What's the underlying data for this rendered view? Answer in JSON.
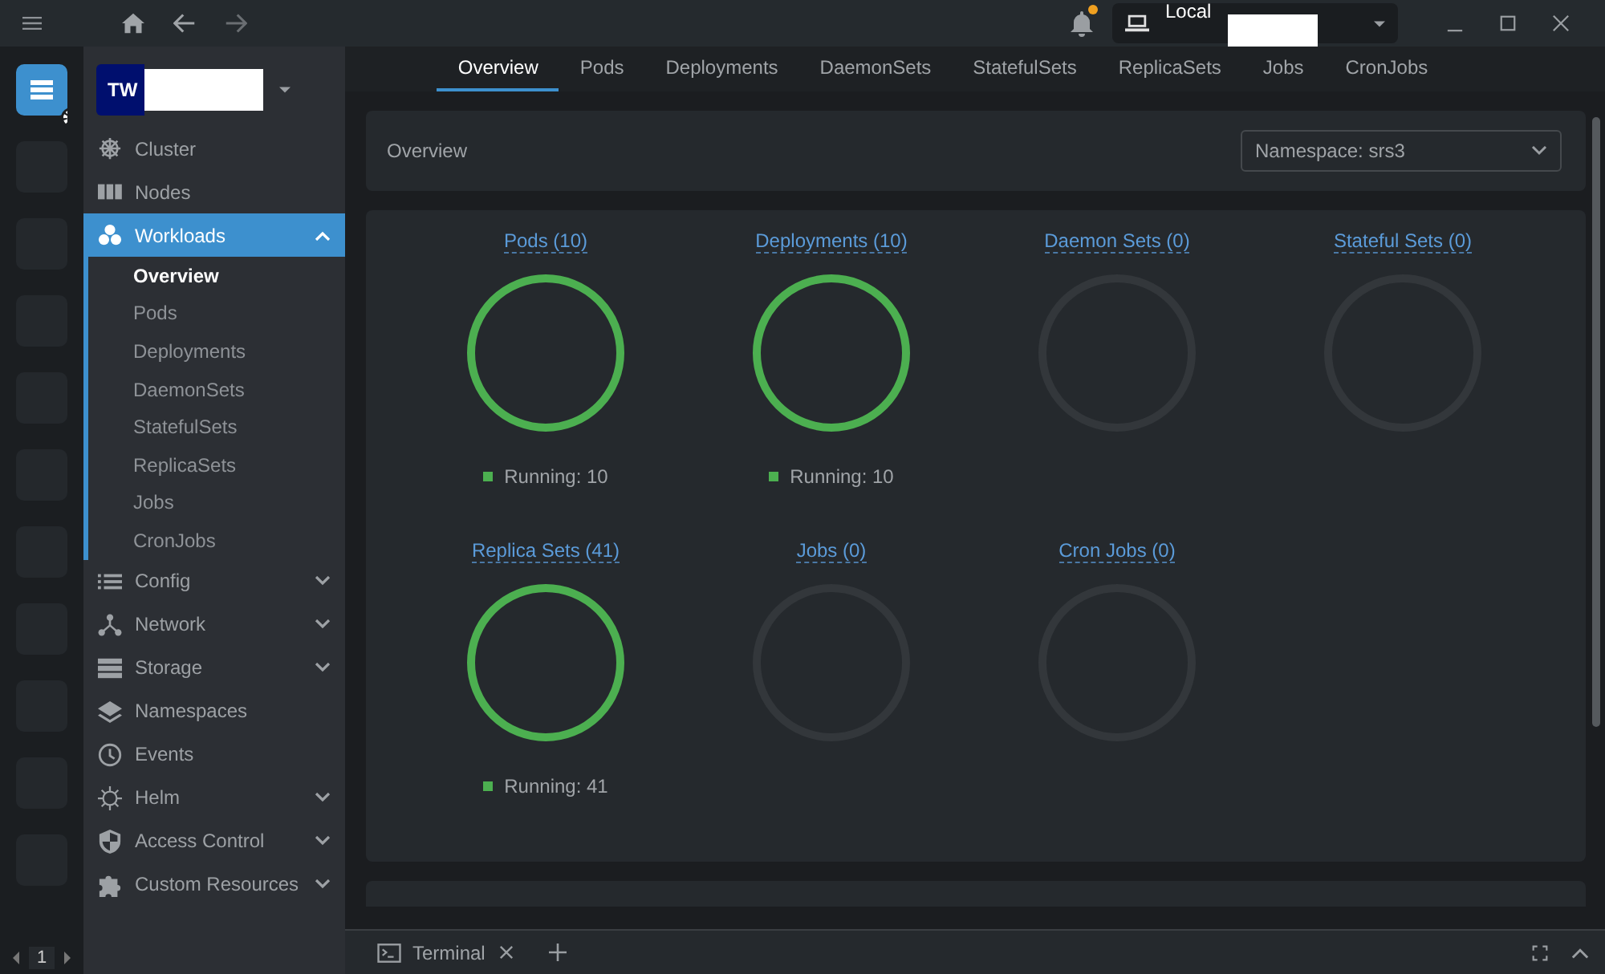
{
  "topbar": {
    "context": {
      "label": "Local"
    },
    "notification": {
      "unread": true
    }
  },
  "hotbar": {
    "items": [
      {
        "selected": true
      },
      {
        "selected": false
      },
      {
        "selected": false
      },
      {
        "selected": false
      },
      {
        "selected": false
      },
      {
        "selected": false
      },
      {
        "selected": false
      },
      {
        "selected": false
      },
      {
        "selected": false
      },
      {
        "selected": false
      },
      {
        "selected": false
      }
    ],
    "page": "1"
  },
  "cluster": {
    "badge": "TW"
  },
  "sidebar": {
    "items": [
      {
        "label": "Cluster",
        "selected": false
      },
      {
        "label": "Nodes",
        "selected": false
      },
      {
        "label": "Workloads",
        "selected": true,
        "expanded": true,
        "children": [
          {
            "label": "Overview",
            "selected": true
          },
          {
            "label": "Pods",
            "selected": false
          },
          {
            "label": "Deployments",
            "selected": false
          },
          {
            "label": "DaemonSets",
            "selected": false
          },
          {
            "label": "StatefulSets",
            "selected": false
          },
          {
            "label": "ReplicaSets",
            "selected": false
          },
          {
            "label": "Jobs",
            "selected": false
          },
          {
            "label": "CronJobs",
            "selected": false
          }
        ]
      },
      {
        "label": "Config",
        "selected": false,
        "expanded": false
      },
      {
        "label": "Network",
        "selected": false,
        "expanded": false
      },
      {
        "label": "Storage",
        "selected": false,
        "expanded": false
      },
      {
        "label": "Namespaces",
        "selected": false
      },
      {
        "label": "Events",
        "selected": false
      },
      {
        "label": "Helm",
        "selected": false,
        "expanded": false
      },
      {
        "label": "Access Control",
        "selected": false,
        "expanded": false
      },
      {
        "label": "Custom Resources",
        "selected": false,
        "expanded": false
      }
    ]
  },
  "tabs": [
    {
      "label": "Overview",
      "selected": true
    },
    {
      "label": "Pods",
      "selected": false
    },
    {
      "label": "Deployments",
      "selected": false
    },
    {
      "label": "DaemonSets",
      "selected": false
    },
    {
      "label": "StatefulSets",
      "selected": false
    },
    {
      "label": "ReplicaSets",
      "selected": false
    },
    {
      "label": "Jobs",
      "selected": false
    },
    {
      "label": "CronJobs",
      "selected": false
    }
  ],
  "overview": {
    "title": "Overview",
    "namespace_select": {
      "value": "Namespace: srs3"
    },
    "workloads": [
      {
        "title": "Pods (10)",
        "kind": "running",
        "legend": "Running: 10"
      },
      {
        "title": "Deployments (10)",
        "kind": "running",
        "legend": "Running: 10"
      },
      {
        "title": "Daemon Sets (0)",
        "kind": "empty"
      },
      {
        "title": "Stateful Sets (0)",
        "kind": "empty"
      },
      {
        "title": "Replica Sets (41)",
        "kind": "running",
        "legend": "Running: 41"
      },
      {
        "title": "Jobs (0)",
        "kind": "empty"
      },
      {
        "title": "Cron Jobs (0)",
        "kind": "empty"
      }
    ]
  },
  "dock": {
    "tabs": [
      {
        "label": "Terminal"
      }
    ]
  }
}
